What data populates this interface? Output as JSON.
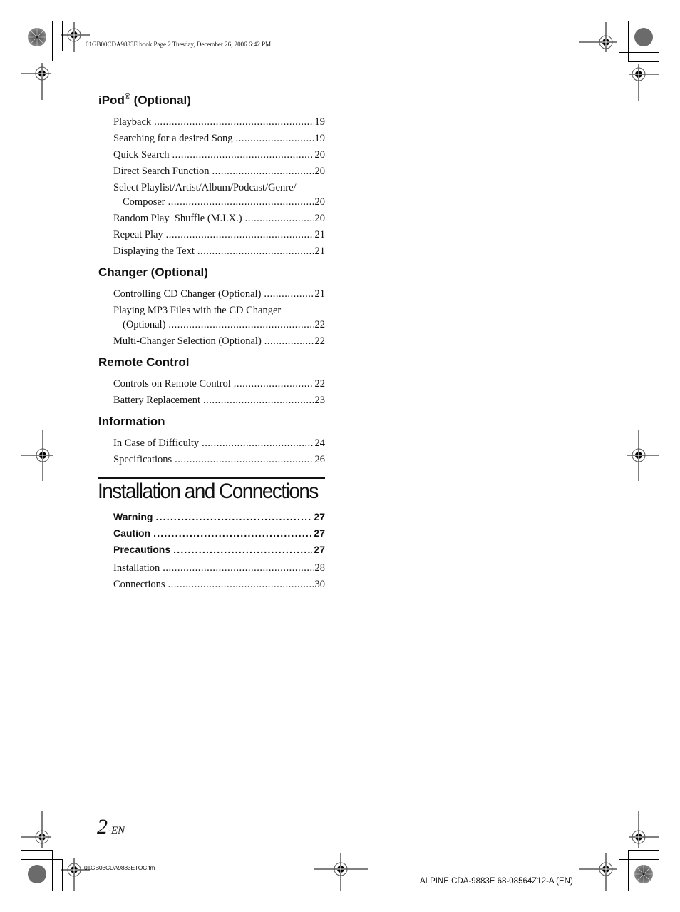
{
  "print_header": "01GB00CDA9883E.book  Page 2  Tuesday, December 26, 2006  6:42 PM",
  "print_footer_left": "01GB03CDA9883ETOC.fm",
  "print_footer_right": "ALPINE CDA-9883E 68-08564Z12-A (EN)",
  "page_number": {
    "number": "2",
    "suffix": "-EN"
  },
  "toc": {
    "ipod": {
      "title": "iPod",
      "title_reg": "®",
      "title_suffix": " (Optional)",
      "entries": [
        {
          "label": "Playback",
          "page": "19"
        },
        {
          "label": "Searching for a desired Song",
          "page": "19"
        },
        {
          "label": "Quick Search",
          "page": "20"
        },
        {
          "label": "Direct Search Function",
          "page": "20"
        },
        {
          "label_line1": "Select Playlist/Artist/Album/Podcast/Genre/",
          "label_line2": "Composer",
          "page": "20"
        },
        {
          "label": "Random Play  Shuffle (M.I.X.)",
          "page": "20"
        },
        {
          "label": "Repeat Play",
          "page": "21"
        },
        {
          "label": "Displaying the Text",
          "page": "21"
        }
      ]
    },
    "changer": {
      "title": "Changer (Optional)",
      "entries": [
        {
          "label": "Controlling CD Changer (Optional)",
          "page": "21"
        },
        {
          "label_line1": "Playing MP3 Files with the CD Changer",
          "label_line2": "(Optional)",
          "page": "22"
        },
        {
          "label": "Multi-Changer Selection (Optional)",
          "page": "22"
        }
      ]
    },
    "remote": {
      "title": "Remote Control",
      "entries": [
        {
          "label": "Controls on Remote Control",
          "page": "22"
        },
        {
          "label": "Battery Replacement",
          "page": "23"
        }
      ]
    },
    "information": {
      "title": "Information",
      "entries": [
        {
          "label": "In Case of Difficulty",
          "page": "24"
        },
        {
          "label": "Specifications",
          "page": "26"
        }
      ]
    },
    "installation": {
      "title": "Installation and Connections",
      "bold_entries": [
        {
          "label": "Warning",
          "page": "27"
        },
        {
          "label": "Caution",
          "page": "27"
        },
        {
          "label": "Precautions",
          "page": "27"
        }
      ],
      "entries": [
        {
          "label": "Installation",
          "page": "28"
        },
        {
          "label": "Connections",
          "page": "30"
        }
      ]
    }
  }
}
